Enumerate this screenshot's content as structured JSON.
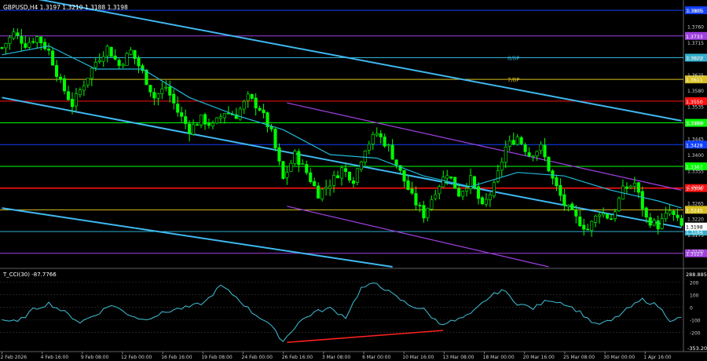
{
  "header": {
    "symbol_line": "GBPUSD,H4  1.3197 1.3210 1.3188 1.3198"
  },
  "indicator": {
    "label": "T_CCI(30) -87.7766",
    "scale_top": "288.8859",
    "scale_bottom": "-353.2072"
  },
  "colors": {
    "background": "#000000",
    "bull_candle": "#00ff00",
    "bear_candle": "#00ff00",
    "ma_line": "#20b8d8",
    "main_channel": "#40b8f0",
    "purple_channel": "#a040e0",
    "red_level": "#ff1010",
    "yellow_level": "#d8c020",
    "cyan_level": "#30b0d0",
    "blue_level": "#1040ff",
    "cci_line": "#40c0d8",
    "divergence": "#ff2020",
    "price_current_bg": "#ffffff"
  },
  "chart_data": [
    {
      "type": "candlestick",
      "title": "GBPUSD,H4",
      "ylim": [
        1.3085,
        1.3825
      ],
      "price_ticks": [
        "1.3805",
        "1.3760",
        "1.3715",
        "1.3672",
        "1.3625",
        "1.3580",
        "1.3535",
        "1.3490",
        "1.3445",
        "1.3400",
        "1.3355",
        "1.3310",
        "1.3265",
        "1.3220",
        "1.3175",
        "1.3130"
      ],
      "x_ticks": [
        "2 Feb 2026",
        "4 Feb 16:00",
        "9 Feb 08:00",
        "12 Feb 00:00",
        "16 Feb 16:00",
        "19 Feb 08:00",
        "24 Feb 00:00",
        "26 Feb 16:00",
        "3 Mar 08:00",
        "6 Mar 00:00",
        "10 Mar 16:00",
        "13 Mar 08:00",
        "18 Mar 00:00",
        "20 Mar 16:00",
        "25 Mar 08:00",
        "30 Mar 00:00",
        "1 Apr 16:00"
      ],
      "close_path": [
        [
          0,
          1.37
        ],
        [
          3,
          1.374
        ],
        [
          6,
          1.371
        ],
        [
          9,
          1.373
        ],
        [
          12,
          1.369
        ],
        [
          15,
          1.36
        ],
        [
          18,
          1.354
        ],
        [
          21,
          1.36
        ],
        [
          24,
          1.366
        ],
        [
          27,
          1.37
        ],
        [
          30,
          1.365
        ],
        [
          33,
          1.369
        ],
        [
          36,
          1.363
        ],
        [
          39,
          1.356
        ],
        [
          42,
          1.359
        ],
        [
          45,
          1.352
        ],
        [
          48,
          1.347
        ],
        [
          51,
          1.35
        ],
        [
          54,
          1.348
        ],
        [
          57,
          1.352
        ],
        [
          60,
          1.351
        ],
        [
          63,
          1.356
        ],
        [
          66,
          1.353
        ],
        [
          69,
          1.346
        ],
        [
          72,
          1.333
        ],
        [
          75,
          1.34
        ],
        [
          78,
          1.335
        ],
        [
          81,
          1.329
        ],
        [
          84,
          1.332
        ],
        [
          87,
          1.336
        ],
        [
          90,
          1.333
        ],
        [
          93,
          1.342
        ],
        [
          96,
          1.346
        ],
        [
          99,
          1.342
        ],
        [
          102,
          1.335
        ],
        [
          105,
          1.328
        ],
        [
          108,
          1.323
        ],
        [
          111,
          1.33
        ],
        [
          114,
          1.335
        ],
        [
          117,
          1.329
        ],
        [
          120,
          1.333
        ],
        [
          123,
          1.325
        ],
        [
          126,
          1.331
        ],
        [
          129,
          1.342
        ],
        [
          132,
          1.345
        ],
        [
          135,
          1.34
        ],
        [
          138,
          1.342
        ],
        [
          141,
          1.333
        ],
        [
          144,
          1.326
        ],
        [
          147,
          1.322
        ],
        [
          150,
          1.319
        ],
        [
          153,
          1.324
        ],
        [
          156,
          1.322
        ],
        [
          159,
          1.33
        ],
        [
          162,
          1.332
        ],
        [
          165,
          1.322
        ],
        [
          168,
          1.32
        ],
        [
          171,
          1.324
        ],
        [
          174,
          1.3198
        ]
      ],
      "ma_path": [
        [
          0,
          1.368
        ],
        [
          12,
          1.3705
        ],
        [
          24,
          1.364
        ],
        [
          36,
          1.364
        ],
        [
          48,
          1.356
        ],
        [
          60,
          1.351
        ],
        [
          72,
          1.347
        ],
        [
          84,
          1.34
        ],
        [
          96,
          1.339
        ],
        [
          108,
          1.334
        ],
        [
          120,
          1.331
        ],
        [
          132,
          1.335
        ],
        [
          144,
          1.334
        ],
        [
          156,
          1.33
        ],
        [
          168,
          1.327
        ],
        [
          174,
          1.325
        ]
      ],
      "bar_count": 175,
      "levels": [
        {
          "label": "",
          "price_label": "1.3805",
          "price": 1.3805,
          "color": "blue_level"
        },
        {
          "label": "",
          "price_label": "1.3733",
          "price": 1.3733,
          "color": "purple_channel"
        },
        {
          "label": "8/8P",
          "price_label": "1.3672",
          "price": 1.3672,
          "color": "cyan_level"
        },
        {
          "label": "7/8P",
          "price_label": "1.3611",
          "price": 1.3611,
          "color": "yellow_level"
        },
        {
          "label": "",
          "price_label": "1.3550",
          "price": 1.355,
          "color": "red_level"
        },
        {
          "label": "",
          "price_label": "1.3489",
          "price": 1.3489,
          "color": "bull_candle"
        },
        {
          "label": "",
          "price_label": "1.3428",
          "price": 1.3428,
          "color": "blue_level"
        },
        {
          "label": "",
          "price_label": "1.3367",
          "price": 1.3367,
          "color": "bull_candle"
        },
        {
          "label": "",
          "price_label": "1.3306",
          "price": 1.3306,
          "color": "red_level"
        },
        {
          "label": "",
          "price_label": "1.3245",
          "price": 1.3245,
          "color": "yellow_level"
        },
        {
          "label": "",
          "price_label": "1.3184",
          "price": 1.3184,
          "color": "cyan_level"
        },
        {
          "label": "",
          "price_label": "1.3123",
          "price": 1.3123,
          "color": "purple_channel"
        }
      ],
      "current_price": "1.3198",
      "channels": [
        {
          "color": "main_channel",
          "from": [
            0,
            1.3855
          ],
          "to": [
            174,
            1.3495
          ]
        },
        {
          "color": "main_channel",
          "from": [
            0,
            1.356
          ],
          "to": [
            174,
            1.3195
          ]
        },
        {
          "color": "main_channel",
          "from": [
            0,
            1.325
          ],
          "to": [
            100,
            1.3085
          ]
        },
        {
          "color": "purple_channel",
          "from": [
            73,
            1.3545
          ],
          "to": [
            174,
            1.33
          ]
        },
        {
          "color": "purple_channel",
          "from": [
            73,
            1.3255
          ],
          "to": [
            140,
            1.3085
          ]
        }
      ]
    },
    {
      "type": "line",
      "title": "T_CCI(30) -87.7766",
      "ylim": [
        -353.2072,
        288.8859
      ],
      "y_ticks": [
        200,
        100,
        0,
        -100,
        -200
      ],
      "y_tick_labels": [
        "200",
        "100",
        "0",
        "-100",
        "-200"
      ],
      "cci_path": [
        [
          0,
          -100
        ],
        [
          4,
          -120
        ],
        [
          8,
          -20
        ],
        [
          12,
          30
        ],
        [
          16,
          -40
        ],
        [
          20,
          -120
        ],
        [
          24,
          -60
        ],
        [
          28,
          20
        ],
        [
          32,
          -50
        ],
        [
          36,
          -100
        ],
        [
          40,
          -60
        ],
        [
          44,
          -20
        ],
        [
          48,
          0
        ],
        [
          52,
          40
        ],
        [
          56,
          170
        ],
        [
          60,
          80
        ],
        [
          64,
          -40
        ],
        [
          68,
          -120
        ],
        [
          72,
          -270
        ],
        [
          76,
          -120
        ],
        [
          80,
          -40
        ],
        [
          84,
          -10
        ],
        [
          88,
          -80
        ],
        [
          92,
          150
        ],
        [
          96,
          190
        ],
        [
          100,
          100
        ],
        [
          104,
          20
        ],
        [
          108,
          -20
        ],
        [
          112,
          -130
        ],
        [
          116,
          -110
        ],
        [
          120,
          -60
        ],
        [
          124,
          60
        ],
        [
          128,
          140
        ],
        [
          132,
          30
        ],
        [
          136,
          -10
        ],
        [
          140,
          60
        ],
        [
          144,
          30
        ],
        [
          148,
          -40
        ],
        [
          152,
          -140
        ],
        [
          156,
          -110
        ],
        [
          160,
          -20
        ],
        [
          164,
          60
        ],
        [
          168,
          10
        ],
        [
          171,
          -100
        ],
        [
          174,
          -88
        ]
      ],
      "divergence_line": {
        "from": [
          73,
          -280
        ],
        "to": [
          113,
          -185
        ]
      }
    }
  ]
}
